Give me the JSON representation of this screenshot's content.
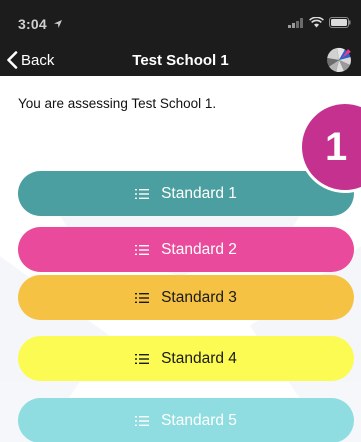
{
  "status": {
    "time": "3:04"
  },
  "nav": {
    "back_label": "Back",
    "title": "Test School 1"
  },
  "main": {
    "assessing_text": "You are assessing Test School 1.",
    "badge_number": "1",
    "standards": [
      {
        "label": "Standard 1",
        "bg": "#4b9fa0",
        "fg": "#ffffff"
      },
      {
        "label": "Standard 2",
        "bg": "#ea4a9b",
        "fg": "#ffffff"
      },
      {
        "label": "Standard 3",
        "bg": "#f6c243",
        "fg": "#1a1a1a"
      },
      {
        "label": "Standard 4",
        "bg": "#fbfb54",
        "fg": "#1a1a1a"
      },
      {
        "label": "Standard 5",
        "bg": "#8fdde0",
        "fg": "#ffffff"
      }
    ]
  },
  "colors": {
    "topbar": "#1c1c1c",
    "badge": "#c4318e"
  },
  "icons": {
    "status": [
      "location-arrow-icon",
      "signal-icon",
      "wifi-icon",
      "battery-icon"
    ],
    "nav": [
      "chevron-left-icon",
      "pinwheel-logo-icon"
    ],
    "standard": "list-icon"
  }
}
